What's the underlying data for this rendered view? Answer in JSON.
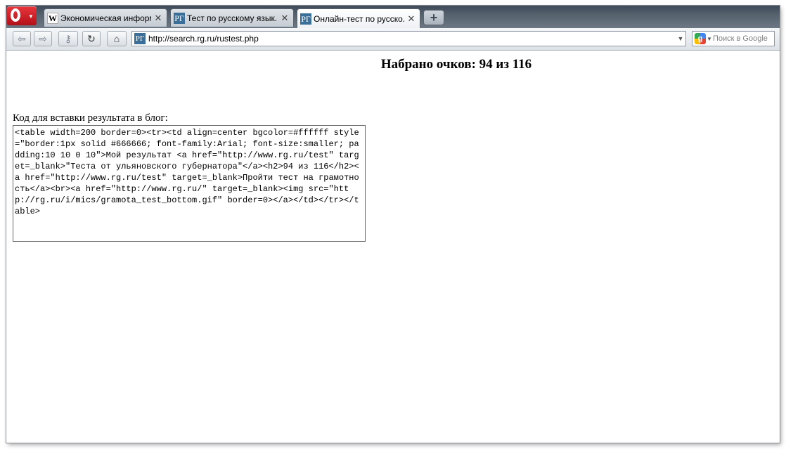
{
  "browser": {
    "tabs": [
      {
        "label": "Экономическая информ...",
        "favicon": "W"
      },
      {
        "label": "Тест по русскому язык...",
        "favicon": "РГ"
      },
      {
        "label": "Онлайн-тест по русско...",
        "favicon": "РГ",
        "active": true
      }
    ],
    "new_tab_label": "+",
    "close_glyph": "✕",
    "address": {
      "favicon": "РГ",
      "url": "http://search.rg.ru/rustest.php",
      "dropdown": "▼"
    },
    "search": {
      "placeholder": "Поиск в Google",
      "engine_icon": "g"
    },
    "toolbar_icons": [
      "back-icon",
      "forward-icon",
      "key-icon",
      "reload-icon",
      "home-icon"
    ],
    "accent": "#3a6f9a"
  },
  "page": {
    "score": "Набрано очков: 94 из 116",
    "embed_label": "Код для вставки результата в блог:",
    "embed_code": "<table width=200 border=0><tr><td align=center bgcolor=#ffffff style=\"border:1px solid #666666; font-family:Arial; font-size:smaller; padding:10 10 0 10\">Мой результат <a href=\"http://www.rg.ru/test\" target=_blank>\"Теста от ульяновского губернатора\"</a><h2>94 из 116</h2><a href=\"http://www.rg.ru/test\" target=_blank>Пройти тест на грамотность</a><br><a href=\"http://www.rg.ru/\" target=_blank><img src=\"http://rg.ru/i/mics/gramota_test_bottom.gif\" border=0></a></td></tr></table>"
  }
}
